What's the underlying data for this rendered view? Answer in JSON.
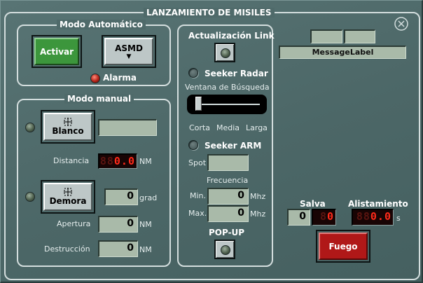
{
  "window": {
    "title": "LANZAMIENTO DE MISILES"
  },
  "auto_mode": {
    "title": "Modo Automático",
    "activar_label": "Activar",
    "asmd_label": "ASMD",
    "asmd_arrow": "▼",
    "alarma_label": "Alarma"
  },
  "manual_mode": {
    "title": "Modo manual",
    "blanco_label": "Blanco",
    "blanco_value": "",
    "distancia_label": "Distancia",
    "distancia_dim": "88",
    "distancia_lit": "0.0",
    "distancia_unit": "NM",
    "demora_label": "Demora",
    "demora_value": "0",
    "demora_unit": "grad",
    "apertura_label": "Apertura",
    "apertura_value": "0",
    "apertura_unit": "NM",
    "destruccion_label": "Destrucción",
    "destruccion_value": "0",
    "destruccion_unit": "NM"
  },
  "center": {
    "link_label": "Actualización Link",
    "seeker_radar_label": "Seeker Radar",
    "ventana_label": "Ventana de Búsqueda",
    "slider_level": 0,
    "corta_label": "Corta",
    "media_label": "Media",
    "larga_label": "Larga",
    "seeker_arm_label": "Seeker ARM",
    "spot_label": "Spot",
    "spot_value": "",
    "frecuencia_label": "Frecuencia",
    "min_label": "Min.",
    "min_value": "0",
    "min_unit": "Mhz",
    "max_label": "Max.",
    "max_value": "0",
    "max_unit": "Mhz",
    "popup_label": "POP-UP"
  },
  "right": {
    "message_label": "MessageLabel",
    "salva_label": "Salva",
    "salva_value": "0",
    "salva_dim": "8",
    "salva_lit": "0",
    "alistamiento_label": "Alistamiento",
    "alistamiento_dim": "88",
    "alistamiento_lit": "0.0",
    "alistamiento_unit": "s",
    "fuego_label": "Fuego"
  },
  "colors": {
    "panel": "#4f6a6a",
    "field": "#a9baa9",
    "digit_on": "#ff2a1a",
    "fuego": "#b01818",
    "activar": "#3c963c"
  }
}
